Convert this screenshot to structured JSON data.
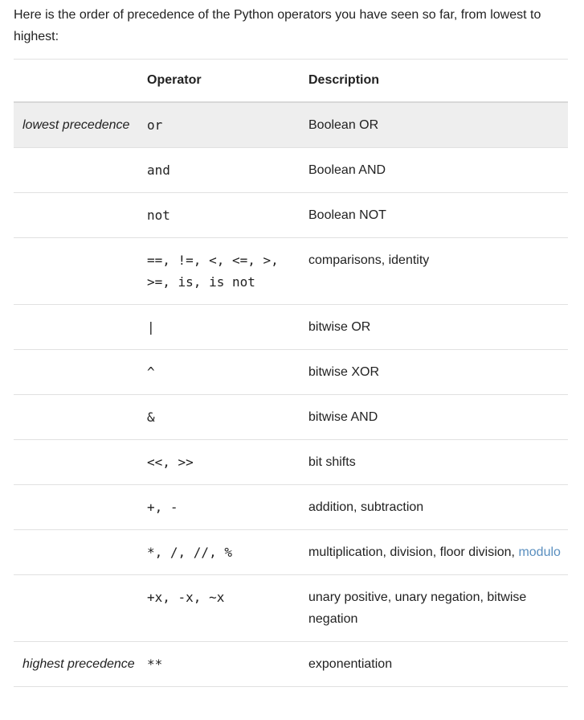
{
  "intro": "Here is the order of precedence of the Python operators you have seen so far, from lowest to highest:",
  "table": {
    "headers": [
      "",
      "Operator",
      "Description"
    ],
    "rows": [
      {
        "precedence": "lowest precedence",
        "operator": "or",
        "description": "Boolean OR",
        "link": ""
      },
      {
        "precedence": "",
        "operator": "and",
        "description": "Boolean AND",
        "link": ""
      },
      {
        "precedence": "",
        "operator": "not",
        "description": "Boolean NOT",
        "link": ""
      },
      {
        "precedence": "",
        "operator": "==, !=, <, <=, >, >=, is, is not",
        "description": "comparisons, identity",
        "link": ""
      },
      {
        "precedence": "",
        "operator": "|",
        "description": "bitwise OR",
        "link": ""
      },
      {
        "precedence": "",
        "operator": "^",
        "description": "bitwise XOR",
        "link": ""
      },
      {
        "precedence": "",
        "operator": "&",
        "description": "bitwise AND",
        "link": ""
      },
      {
        "precedence": "",
        "operator": "<<, >>",
        "description": "bit shifts",
        "link": ""
      },
      {
        "precedence": "",
        "operator": "+, -",
        "description": "addition, subtraction",
        "link": ""
      },
      {
        "precedence": "",
        "operator": "*, /, //, %",
        "description": "multiplication, division, floor division, ",
        "link": "modulo"
      },
      {
        "precedence": "",
        "operator": "+x, -x, ~x",
        "description": "unary positive, unary negation, bitwise negation",
        "link": ""
      },
      {
        "precedence": "highest precedence",
        "operator": "**",
        "description": "exponentiation",
        "link": ""
      }
    ]
  }
}
